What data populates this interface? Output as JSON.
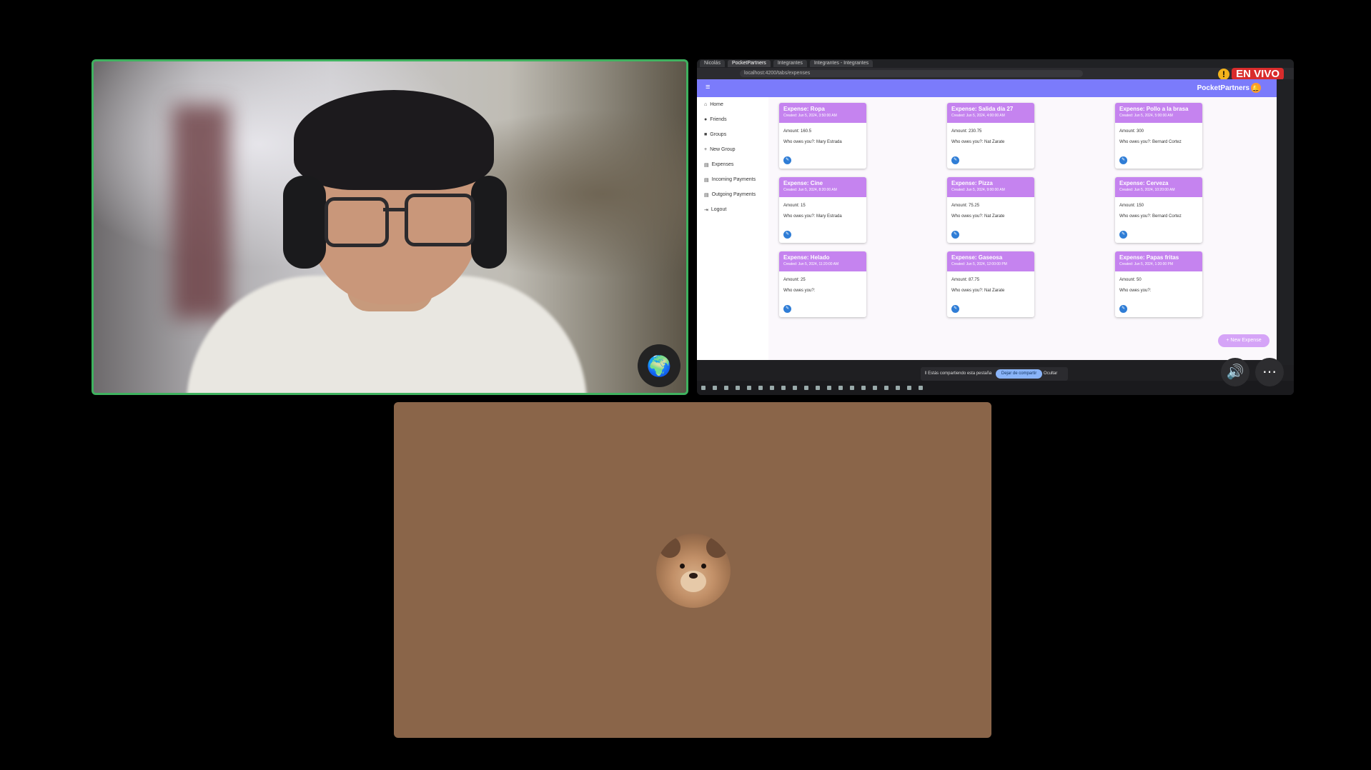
{
  "participant_badge": "🌍",
  "share": {
    "tabs": [
      "Nicolás",
      "PocketPartners",
      "Integrantes",
      "Integrantes - Integrantes"
    ],
    "live_label": "EN VIVO",
    "warning": "!",
    "url": "localhost:4200/tabs/expenses",
    "app": {
      "menu_icon": "≡",
      "brand": "PocketPartners",
      "bell": "🔔"
    },
    "nav": [
      {
        "icon": "⌂",
        "label": "Home"
      },
      {
        "icon": "●",
        "label": "Friends"
      },
      {
        "icon": "■",
        "label": "Groups"
      },
      {
        "icon": "+",
        "label": "New Group"
      },
      {
        "icon": "▤",
        "label": "Expenses"
      },
      {
        "icon": "▤",
        "label": "Incoming Payments"
      },
      {
        "icon": "▤",
        "label": "Outgoing Payments"
      },
      {
        "icon": "⇥",
        "label": "Logout"
      }
    ],
    "cards": [
      {
        "title": "Expense: Ropa",
        "date": "Created: Jun 5, 2024, 3:50:00 AM",
        "amount": "Amount: 160.5",
        "who": "Who owes you?: Mary Estrada"
      },
      {
        "title": "Expense: Salida día 27",
        "date": "Created: Jun 5, 2024, 4:00:00 AM",
        "amount": "Amount: 230.75",
        "who": "Who owes you?: Nat Zarate"
      },
      {
        "title": "Expense: Pollo a la brasa",
        "date": "Created: Jun 5, 2024, 5:00:00 AM",
        "amount": "Amount: 300",
        "who": "Who owes you?: Bernard Cortez"
      },
      {
        "title": "Expense: Cine",
        "date": "Created: Jun 5, 2024, 8:20:00 AM",
        "amount": "Amount: 15",
        "who": "Who owes you?: Mary Estrada"
      },
      {
        "title": "Expense: Pizza",
        "date": "Created: Jun 5, 2024, 9:00:00 AM",
        "amount": "Amount: 75.25",
        "who": "Who owes you?: Nat Zarate"
      },
      {
        "title": "Expense: Cerveza",
        "date": "Created: Jun 5, 2024, 10:20:00 AM",
        "amount": "Amount: 150",
        "who": "Who owes you?: Bernard Cortez"
      },
      {
        "title": "Expense: Helado",
        "date": "Created: Jun 5, 2024, 11:20:00 AM",
        "amount": "Amount: 25",
        "who": "Who owes you?:"
      },
      {
        "title": "Expense: Gaseosa",
        "date": "Created: Jun 5, 2024, 12:00:00 PM",
        "amount": "Amount: 87.75",
        "who": "Who owes you?: Nat Zarate"
      },
      {
        "title": "Expense: Papas fritas",
        "date": "Created: Jun 5, 2024, 1:20:00 PM",
        "amount": "Amount: 50",
        "who": "Who owes you?:"
      }
    ],
    "fab_label": "+ New Expense",
    "share_bar": {
      "text": "‖ Estás compartiendo esta pestaña",
      "stop": "Dejar de compartir",
      "hide": "Ocultar"
    },
    "controls": {
      "speaker": "🔊",
      "more": "⋯"
    }
  }
}
